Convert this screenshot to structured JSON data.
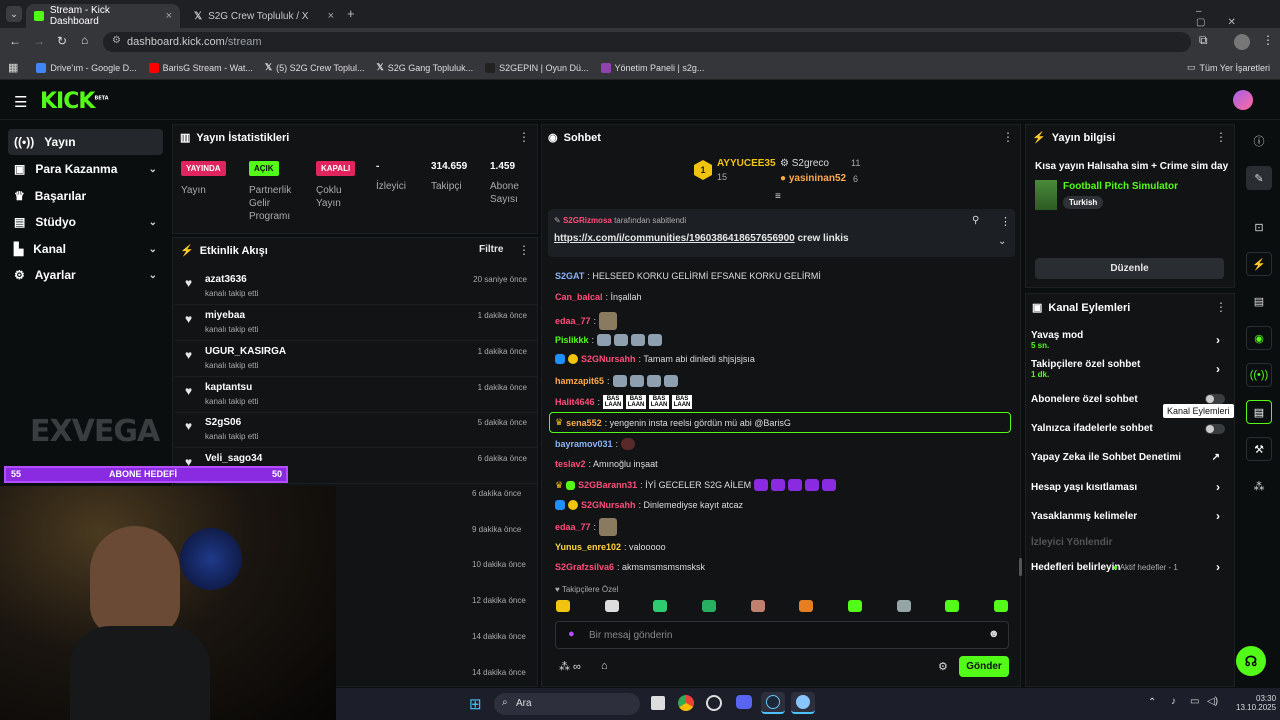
{
  "browser": {
    "tabs": [
      {
        "title": "Stream - Kick Dashboard",
        "icon": "kick-icon"
      },
      {
        "title": "S2G Crew Topluluk / X",
        "icon": "x-icon"
      }
    ],
    "url_host": "dashboard.kick.com",
    "url_path": "/stream",
    "bookmarks": [
      "Drive'ım - Google D...",
      "BarisG Stream - Wat...",
      "(5) S2G Crew Toplul...",
      "S2G Gang Topluluk...",
      "S2GEPIN | Oyun Dü...",
      "Yönetim Paneli | s2g..."
    ],
    "all_bookmarks": "Tüm Yer İşaretleri"
  },
  "kick": {
    "logo": "KICK",
    "beta": "BETA"
  },
  "nav": [
    {
      "label": "Yayın",
      "icon": "broadcast-icon",
      "chevron": false
    },
    {
      "label": "Para Kazanma",
      "icon": "money-icon",
      "chevron": true
    },
    {
      "label": "Başarılar",
      "icon": "trophy-icon",
      "chevron": false
    },
    {
      "label": "Stüdyo",
      "icon": "studio-icon",
      "chevron": true
    },
    {
      "label": "Kanal",
      "icon": "channel-icon",
      "chevron": true
    },
    {
      "label": "Ayarlar",
      "icon": "gear-icon",
      "chevron": true
    }
  ],
  "stats": {
    "title": "Yayın İstatistikleri",
    "yayin": {
      "badge": "YAYINDA",
      "label": "Yayın"
    },
    "partner": {
      "badge": "AÇIK",
      "label": "Partnerlik Gelir Programı"
    },
    "multi": {
      "badge": "KAPALI",
      "label": "Çoklu Yayın"
    },
    "viewers": {
      "value": "-",
      "label": "İzleyici"
    },
    "followers": {
      "value": "314.659",
      "label": "Takipçi"
    },
    "subs": {
      "value": "1.459",
      "label": "Abone Sayısı"
    }
  },
  "events": {
    "title": "Etkinlik Akışı",
    "filter": "Filtre",
    "items": [
      {
        "name": "azat3636",
        "sub": "kanalı takip etti",
        "time": "20 saniye önce"
      },
      {
        "name": "miyebaa",
        "sub": "kanalı takip etti",
        "time": "1 dakika önce"
      },
      {
        "name": "UGUR_KASIRGA",
        "sub": "kanalı takip etti",
        "time": "1 dakika önce"
      },
      {
        "name": "kaptantsu",
        "sub": "kanalı takip etti",
        "time": "1 dakika önce"
      },
      {
        "name": "S2gS06",
        "sub": "kanalı takip etti",
        "time": "5 dakika önce"
      },
      {
        "name": "Veli_sago34",
        "sub": "",
        "time": "6 dakika önce"
      }
    ],
    "more_times": [
      "6 dakika önce",
      "9 dakika önce",
      "10 dakika önce",
      "12 dakika önce",
      "14 dakika önce",
      "14 dakika önce"
    ]
  },
  "overlay": {
    "brand": "EXVEGA",
    "goal_left": "55",
    "goal_title": "ABONE HEDEFİ",
    "goal_right": "50",
    "goal_fraction": 1.0
  },
  "chat": {
    "title": "Sohbet",
    "top1": {
      "name": "AYYUCEE35",
      "count": "15",
      "rank": "1"
    },
    "top2": {
      "name": "S2greco",
      "count": "11"
    },
    "top3": {
      "name": "yasininan52",
      "count": "6"
    },
    "pinned_by": "S2GRizmosa",
    "pinned_suffix": "tarafından sabitlendi",
    "pinned_link": "https://x.com/i/communities/1960386418657656900",
    "pinned_text": "crew linkis",
    "messages": [
      {
        "user": "S2GAT",
        "color": "#8ab4f8",
        "text": ": HELSEED KORKU GELİRMİ EFSANE KORKU GELİRMİ"
      },
      {
        "user": "Can_balcal",
        "color": "#ff4d7a",
        "text": ": İnşallah"
      },
      {
        "user": "edaa_77",
        "color": "#ff4d7a",
        "text": ":"
      },
      {
        "user": "Pislikkk",
        "color": "#53fc18",
        "text": ":"
      },
      {
        "user": "S2GNursahh",
        "color": "#ff4d7a",
        "text": ": Tamam abi dinledi shjsjsjsıa"
      },
      {
        "user": "hamzapit65",
        "color": "#ffa94d",
        "text": ":"
      },
      {
        "user": "Halit4646",
        "color": "#ff4d7a",
        "text": ":"
      },
      {
        "user": "sena552",
        "color": "#ffa94d",
        "text": ": yengenin insta reelsi gördün mü abi @BarisG"
      },
      {
        "user": "bayramov031",
        "color": "#8ab4f8",
        "text": ":"
      },
      {
        "user": "teslav2",
        "color": "#ff4d7a",
        "text": ": Amınoğlu inşaat"
      },
      {
        "user": "S2GBarann31",
        "color": "#ff4d7a",
        "text": ": İYİ GECELER S2G AİLEM"
      },
      {
        "user": "S2GNursahh",
        "color": "#ff4d7a",
        "text": ": Dinlemediyse kayıt atcaz"
      },
      {
        "user": "edaa_77",
        "color": "#ff4d7a",
        "text": ":"
      },
      {
        "user": "Yunus_enre102",
        "color": "#ffd43b",
        "text": ": valooooo"
      },
      {
        "user": "S2Grafzsilva6",
        "color": "#ff4d7a",
        "text": ": akmsmsmsmsmsksk"
      }
    ],
    "bas_label": "BAS LAAN",
    "followers_only": "Takipçilere Özel",
    "input_placeholder": "Bir mesaj gönderin",
    "send": "Gönder"
  },
  "info": {
    "title": "Yayın bilgisi",
    "stream_title": "Kısa yayın Halısaha sim + Crime sim day",
    "game": "Football Pitch Simulator",
    "language": "Turkish",
    "edit": "Düzenle"
  },
  "actions": {
    "title": "Kanal Eylemleri",
    "slow": {
      "label": "Yavaş mod",
      "sub": "5 sn."
    },
    "followers": {
      "label": "Takipçilere özel sohbet",
      "sub": "1 dk."
    },
    "subs": {
      "label": "Abonelere özel sohbet"
    },
    "emotes": {
      "label": "Yalnızca ifadelerle sohbet"
    },
    "ai": {
      "label": "Yapay Zeka ile Sohbet Denetimi"
    },
    "age": {
      "label": "Hesap yaşı kısıtlaması"
    },
    "banned": {
      "label": "Yasaklanmış kelimeler"
    },
    "redirect": {
      "label": "İzleyici Yönlendir"
    },
    "goals": {
      "label": "Hedefleri belirleyin",
      "status": "Aktif hedefler - 1"
    }
  },
  "tooltip": "Kanal Eylemleri",
  "taskbar": {
    "search": "Ara",
    "time": "03:30",
    "date": "13.10.2025"
  },
  "colors": {
    "kick_green": "#53fc18",
    "live_red": "#e0245e",
    "panel": "#111315"
  }
}
